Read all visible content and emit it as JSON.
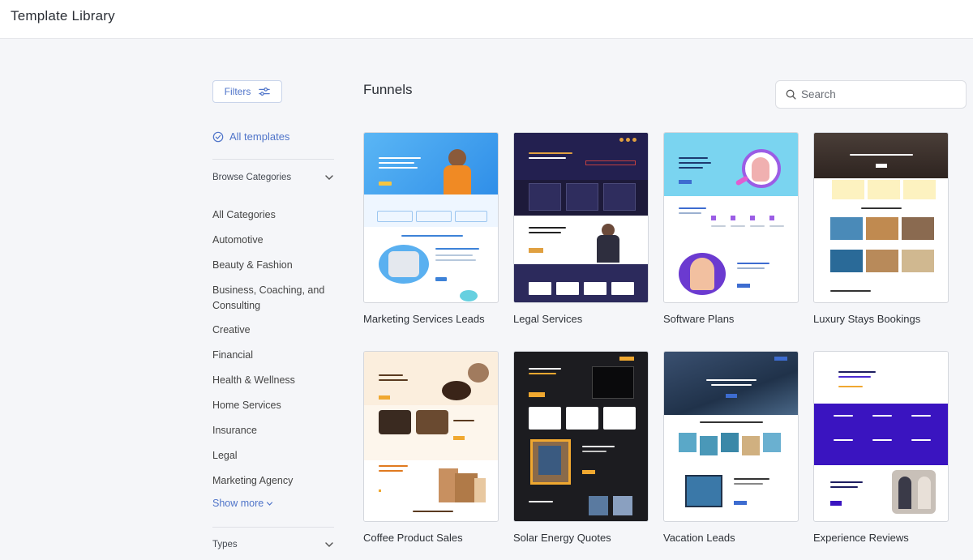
{
  "header": {
    "title": "Template Library"
  },
  "sidebar": {
    "filters_label": "Filters",
    "all_templates_label": "All templates",
    "browse_label": "Browse Categories",
    "categories": [
      "All Categories",
      "Automotive",
      "Beauty & Fashion",
      "Business, Coaching, and Consulting",
      "Creative",
      "Financial",
      "Health & Wellness",
      "Home Services",
      "Insurance",
      "Legal",
      "Marketing Agency"
    ],
    "show_more_label": "Show more",
    "types_label": "Types"
  },
  "main": {
    "section_title": "Funnels",
    "search_placeholder": "Search",
    "templates": [
      {
        "name": "Marketing Services Leads"
      },
      {
        "name": "Legal Services"
      },
      {
        "name": "Software Plans"
      },
      {
        "name": "Luxury Stays Bookings"
      },
      {
        "name": "Coffee Product Sales"
      },
      {
        "name": "Solar Energy Quotes"
      },
      {
        "name": "Vacation Leads"
      },
      {
        "name": "Experience Reviews"
      }
    ]
  },
  "colors": {
    "accent": "#4f74c9",
    "background": "#f5f6f9"
  }
}
